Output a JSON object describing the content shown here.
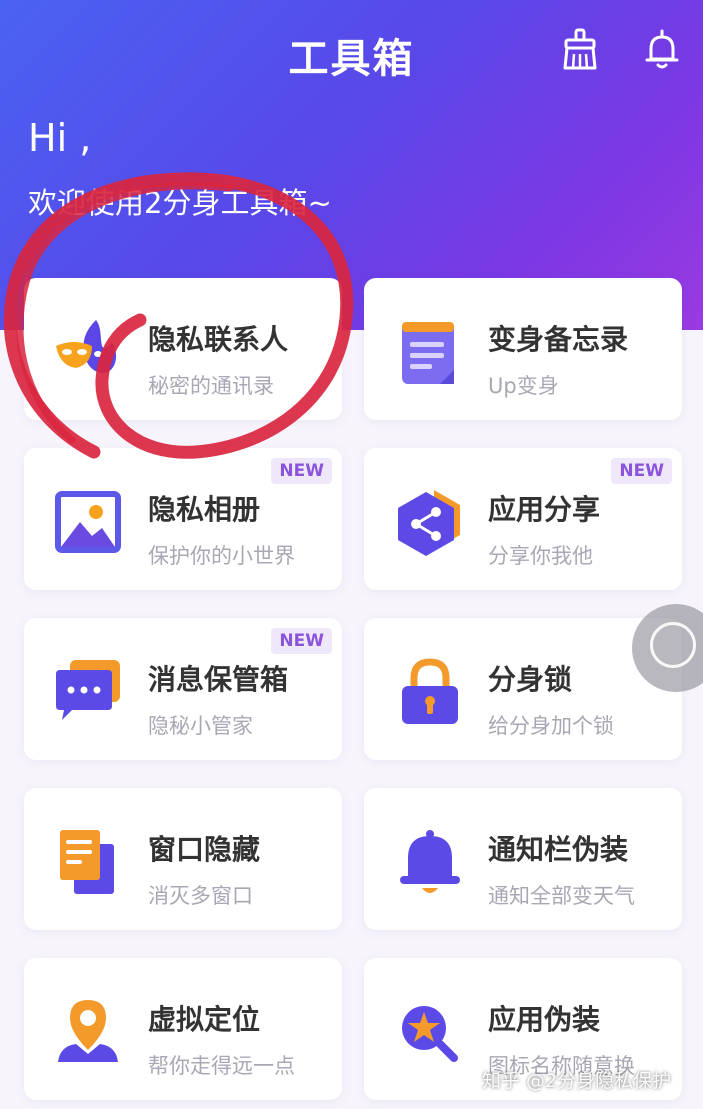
{
  "header": {
    "title": "工具箱",
    "greeting": "Hi ,",
    "welcome": "欢迎使用2分身工具箱~"
  },
  "icons": {
    "clean": "broom-icon",
    "notify": "bell-icon"
  },
  "colors": {
    "hero_start": "#4a62f2",
    "hero_end": "#9a3ae0",
    "badge_text": "#8a55d8",
    "annotation": "#d9263f"
  },
  "tools": [
    {
      "name": "隐私联系人",
      "desc": "秘密的通讯录",
      "badge": "",
      "icon": "mask-icon"
    },
    {
      "name": "变身备忘录",
      "desc": "Up变身",
      "badge": "",
      "icon": "memo-icon"
    },
    {
      "name": "隐私相册",
      "desc": "保护你的小世界",
      "badge": "NEW",
      "icon": "photo-icon"
    },
    {
      "name": "应用分享",
      "desc": "分享你我他",
      "badge": "NEW",
      "icon": "share-icon"
    },
    {
      "name": "消息保管箱",
      "desc": "隐秘小管家",
      "badge": "NEW",
      "icon": "message-icon"
    },
    {
      "name": "分身锁",
      "desc": "给分身加个锁",
      "badge": "",
      "icon": "lock-icon"
    },
    {
      "name": "窗口隐藏",
      "desc": "消灭多窗口",
      "badge": "",
      "icon": "window-icon"
    },
    {
      "name": "通知栏伪装",
      "desc": "通知全部变天气",
      "badge": "",
      "icon": "notification-bell-icon"
    },
    {
      "name": "虚拟定位",
      "desc": "帮你走得远一点",
      "badge": "",
      "icon": "location-icon"
    },
    {
      "name": "应用伪装",
      "desc": "图标名称随意换",
      "badge": "",
      "icon": "disguise-icon"
    }
  ],
  "watermark": "知乎 @2分身隐私保护"
}
